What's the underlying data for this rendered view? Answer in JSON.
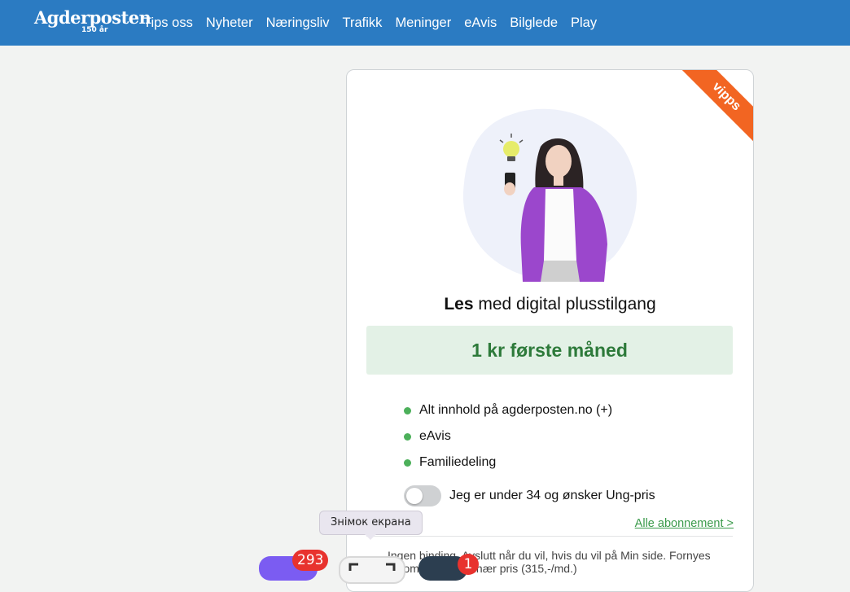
{
  "header": {
    "logo_name": "Agderposten",
    "logo_sub": "150 år",
    "nav": [
      "Tips oss",
      "Nyheter",
      "Næringsliv",
      "Trafikk",
      "Meninger",
      "eAvis",
      "Bilglede",
      "Play"
    ]
  },
  "card": {
    "ribbon": "vipps",
    "headline_bold": "Les",
    "headline_rest": " med digital plusstilgang",
    "offer": "1 kr første måned",
    "features": [
      "Alt innhold på agderposten.no (+)",
      "eAvis",
      "Familiedeling"
    ],
    "toggle_label": "Jeg er under 34 og ønsker Ung-pris",
    "all_subscriptions": "Alle abonnement >",
    "fineprint": "Ingen binding. Avslutt når du vil, hvis du vil på Min side. Fornyes automatisk  til ordinær pris  (315,-/md.)"
  },
  "tooltip": "Знімок екрана",
  "dock": {
    "badge_messages": "293",
    "badge_other": "1"
  },
  "colors": {
    "header_bg": "#2b7bc2",
    "offer_bg": "#e3f1e6",
    "offer_text": "#2d7a3a",
    "ribbon": "#f26522",
    "bullet": "#4cb05a"
  }
}
